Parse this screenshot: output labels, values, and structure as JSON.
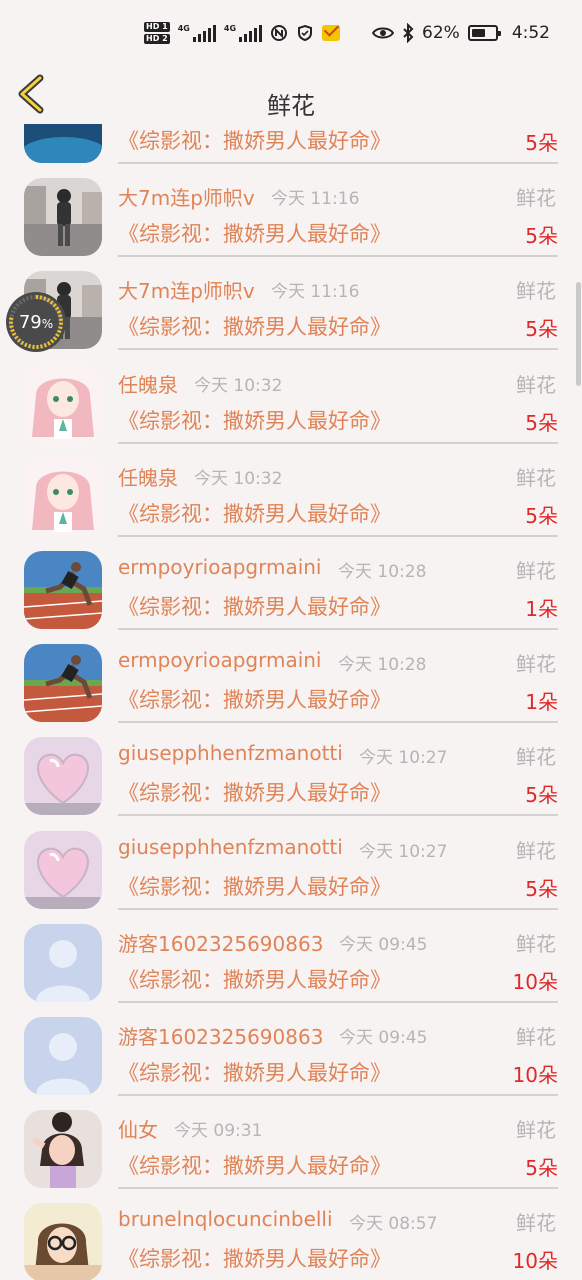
{
  "status_bar": {
    "hd1": "HD 1",
    "hd2": "HD 2",
    "net1": "4G",
    "net2": "4G",
    "battery_pct": "62%",
    "battery_level": 0.62,
    "time": "4:52",
    "icons": [
      "nfc-icon",
      "shield-icon",
      "mail-app-icon",
      "eye-icon",
      "bluetooth-icon",
      "battery-icon"
    ]
  },
  "header": {
    "title": "鲜花"
  },
  "floating_progress": {
    "value": "79",
    "unit": "%",
    "fraction": 0.79
  },
  "gift_type": "鲜花",
  "book_title": "《综影视：撒娇男人最好命》",
  "rows": [
    {
      "name": "",
      "time": "",
      "count": "5朵",
      "avatar": "landscape"
    },
    {
      "name": "大7m连p师帜v",
      "time": "今天 11:16",
      "count": "5朵",
      "avatar": "street"
    },
    {
      "name": "大7m连p师帜v",
      "time": "今天 11:16",
      "count": "5朵",
      "avatar": "street"
    },
    {
      "name": "任魄泉",
      "time": "今天 10:32",
      "count": "5朵",
      "avatar": "anime"
    },
    {
      "name": "任魄泉",
      "time": "今天 10:32",
      "count": "5朵",
      "avatar": "anime"
    },
    {
      "name": "ermpoyrioapgrmaini",
      "time": "今天 10:28",
      "count": "1朵",
      "avatar": "runner"
    },
    {
      "name": "ermpoyrioapgrmaini",
      "time": "今天 10:28",
      "count": "1朵",
      "avatar": "runner"
    },
    {
      "name": "giusepphhenfzmanotti",
      "time": "今天 10:27",
      "count": "5朵",
      "avatar": "heart"
    },
    {
      "name": "giusepphhenfzmanotti",
      "time": "今天 10:27",
      "count": "5朵",
      "avatar": "heart"
    },
    {
      "name": "游客1602325690863",
      "time": "今天 09:45",
      "count": "10朵",
      "avatar": "default"
    },
    {
      "name": "游客1602325690863",
      "time": "今天 09:45",
      "count": "10朵",
      "avatar": "default"
    },
    {
      "name": "仙女",
      "time": "今天 09:31",
      "count": "5朵",
      "avatar": "girl"
    },
    {
      "name": "brunelnqlocuncinbelli",
      "time": "今天 08:57",
      "count": "10朵",
      "avatar": "glasses"
    }
  ]
}
